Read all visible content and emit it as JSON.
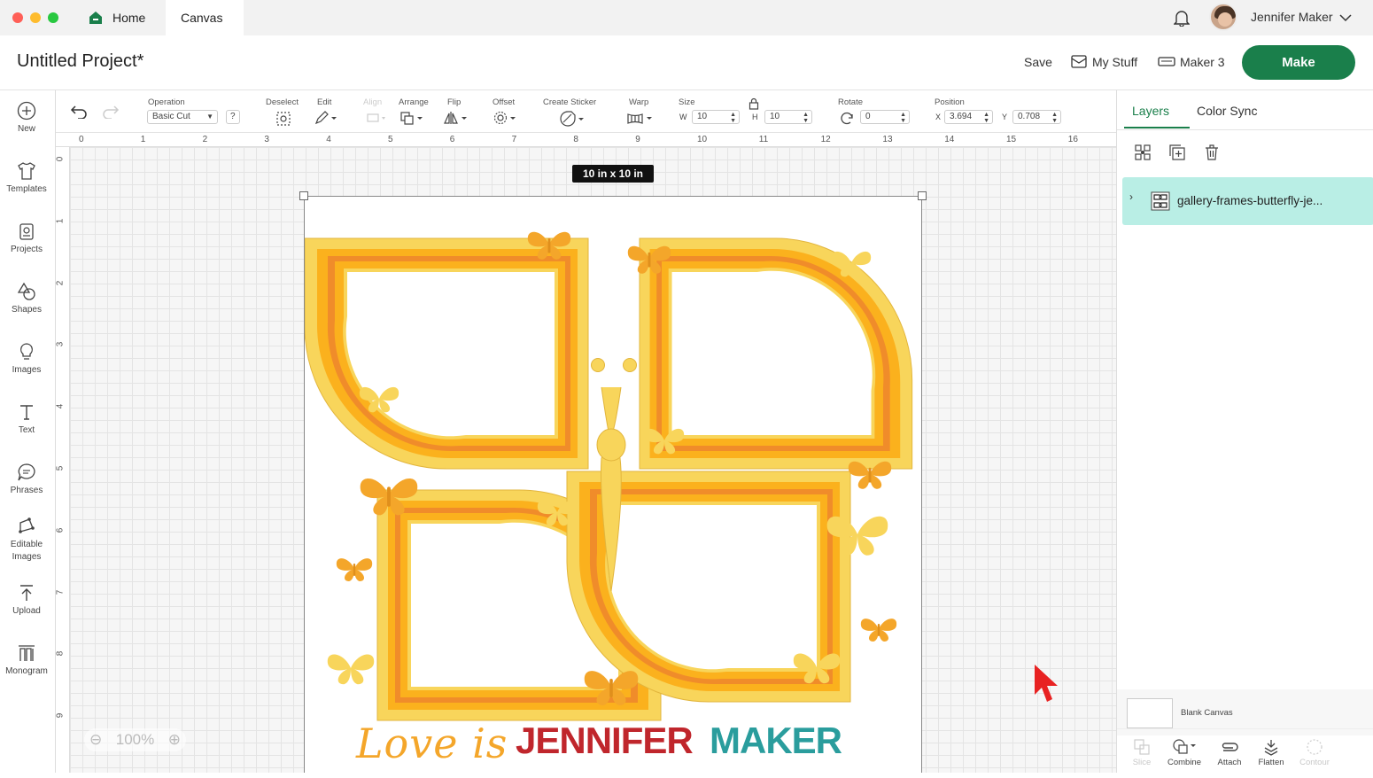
{
  "topbar": {
    "tabs": [
      {
        "label": "Home"
      },
      {
        "label": "Canvas"
      }
    ],
    "user_name": "Jennifer Maker"
  },
  "header": {
    "project_title": "Untitled Project*",
    "save_label": "Save",
    "mystuff_label": "My Stuff",
    "machine_label": "Maker 3",
    "make_label": "Make"
  },
  "sidebar": {
    "items": [
      {
        "label": "New",
        "icon": "plus-circle-icon"
      },
      {
        "label": "Templates",
        "icon": "shirt-icon"
      },
      {
        "label": "Projects",
        "icon": "projects-icon"
      },
      {
        "label": "Shapes",
        "icon": "shapes-icon"
      },
      {
        "label": "Images",
        "icon": "lightbulb-icon"
      },
      {
        "label": "Text",
        "icon": "text-icon"
      },
      {
        "label": "Phrases",
        "icon": "speech-bubble-icon"
      },
      {
        "label": "Editable Images",
        "icon": "editable-images-icon"
      },
      {
        "label": "Upload",
        "icon": "upload-icon"
      },
      {
        "label": "Monogram",
        "icon": "monogram-icon"
      }
    ]
  },
  "toolbar": {
    "operation_label": "Operation",
    "operation_value": "Basic Cut",
    "help_label": "?",
    "deselect_label": "Deselect",
    "edit_label": "Edit",
    "align_label": "Align",
    "arrange_label": "Arrange",
    "flip_label": "Flip",
    "offset_label": "Offset",
    "sticker_label": "Create Sticker",
    "warp_label": "Warp",
    "size_label": "Size",
    "w_label": "W",
    "w_value": "10",
    "h_label": "H",
    "h_value": "10",
    "rotate_label": "Rotate",
    "rotate_value": "0",
    "position_label": "Position",
    "x_label": "X",
    "x_value": "3.694",
    "y_label": "Y",
    "y_value": "0.708"
  },
  "rulers": {
    "top": [
      "0",
      "1",
      "2",
      "3",
      "4",
      "5",
      "6",
      "7",
      "8",
      "9",
      "10",
      "11",
      "12",
      "13",
      "14",
      "15",
      "16"
    ],
    "left": [
      "0",
      "1",
      "2",
      "3",
      "4",
      "5",
      "6",
      "7",
      "8",
      "9"
    ]
  },
  "canvas": {
    "size_badge": "10  in x 10  in",
    "zoom_label": "100%",
    "caption_text": "Love is",
    "watermark_left": "JENNIFER",
    "watermark_right": "MAKER"
  },
  "right_panel": {
    "tabs": [
      {
        "label": "Layers"
      },
      {
        "label": "Color Sync"
      }
    ],
    "layer_name": "gallery-frames-butterfly-je...",
    "blank_canvas_label": "Blank Canvas",
    "bottom_tools": [
      {
        "label": "Slice",
        "enabled": false
      },
      {
        "label": "Combine",
        "enabled": true
      },
      {
        "label": "Attach",
        "enabled": true
      },
      {
        "label": "Flatten",
        "enabled": true
      },
      {
        "label": "Contour",
        "enabled": false
      }
    ]
  },
  "colors": {
    "make_button": "#1a7f4b",
    "layer_highlight": "#b9eee5",
    "frame_light": "#f8d55b",
    "frame_mid": "#fbb11d",
    "frame_dark": "#f08c2a",
    "watermark_red": "#c0262c",
    "watermark_teal": "#2a9d9d"
  }
}
